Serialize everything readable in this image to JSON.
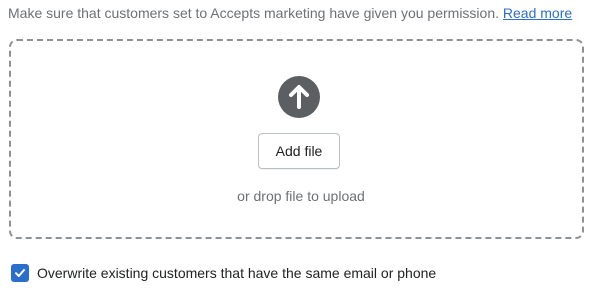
{
  "notice": {
    "text": "Make sure that customers set to Accepts marketing have given you permission.",
    "link_label": "Read more"
  },
  "dropzone": {
    "icon": "upload-arrow-icon",
    "add_file_label": "Add file",
    "drop_hint": "or drop file to upload"
  },
  "overwrite": {
    "checked": true,
    "label": "Overwrite existing customers that have the same email or phone"
  },
  "colors": {
    "accent": "#2c6ecb",
    "icon_fill": "#5c5f62",
    "border": "#8c9196",
    "muted_text": "#6d7175"
  }
}
